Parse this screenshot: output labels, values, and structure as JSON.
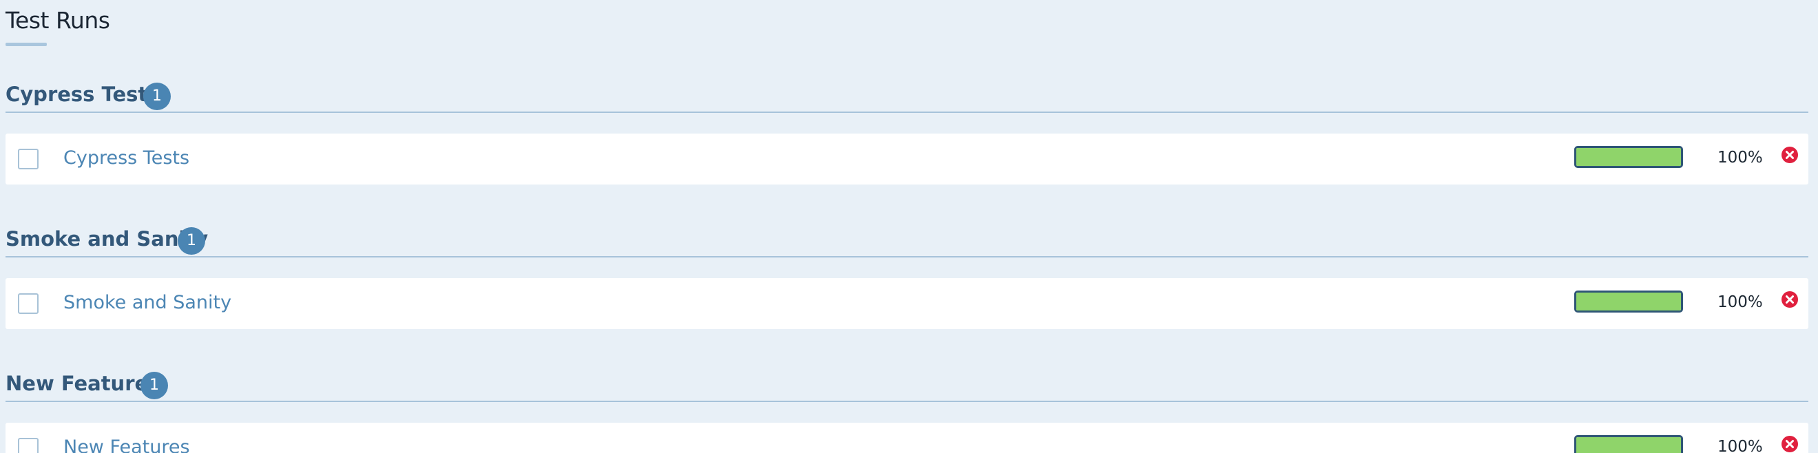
{
  "page": {
    "title": "Test Runs"
  },
  "groups": [
    {
      "name": "Cypress Tests",
      "count": "1",
      "run": {
        "label": "Cypress Tests",
        "progress_percent": 100,
        "progress_text": "100%",
        "checked": false
      }
    },
    {
      "name": "Smoke and Sanity",
      "count": "1",
      "run": {
        "label": "Smoke and Sanity",
        "progress_percent": 100,
        "progress_text": "100%",
        "checked": false
      }
    },
    {
      "name": "New Features",
      "count": "1",
      "run": {
        "label": "New Features",
        "progress_percent": 100,
        "progress_text": "100%",
        "checked": false
      }
    }
  ],
  "icons": {
    "delete": "close-circle-icon"
  },
  "colors": {
    "background": "#e8f0f7",
    "group_title": "#33587a",
    "badge": "#4a85b3",
    "run_link": "#4c86b4",
    "progress_fill": "#8fd46a",
    "progress_border": "#2f5676",
    "delete": "#e0203e"
  }
}
